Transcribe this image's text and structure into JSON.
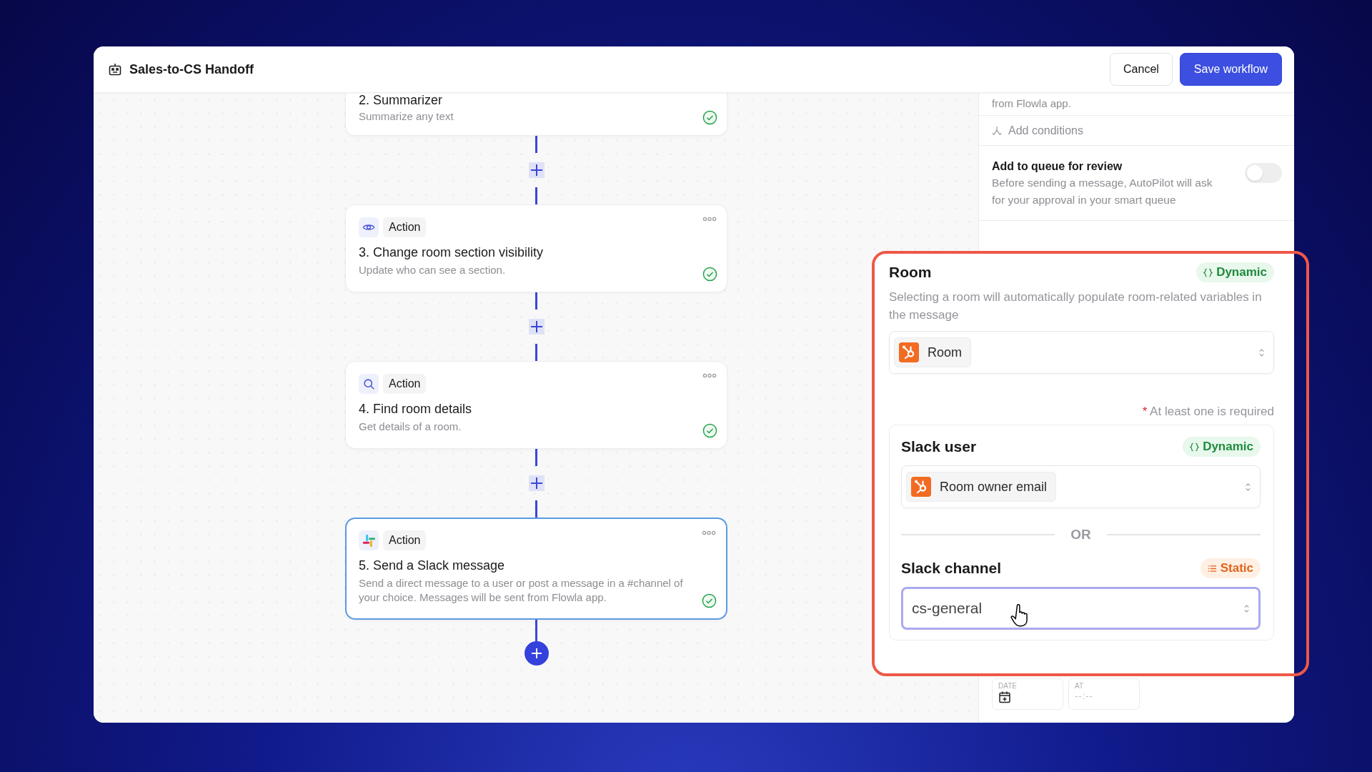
{
  "window": {
    "title": "Sales-to-CS Handoff"
  },
  "header_buttons": [
    {
      "label": "Cancel",
      "kind": "secondary"
    },
    {
      "label": "Save workflow",
      "kind": "primary"
    }
  ],
  "nodes": [
    {
      "title": "2. Summarizer",
      "description": "Summarize any text",
      "done": true,
      "selected": false
    },
    {
      "badge": "Action",
      "kind": "visibility",
      "title": "3. Change room section visibility",
      "description": "Update who can see a section.",
      "done": true,
      "selected": false
    },
    {
      "badge": "Action",
      "kind": "lookup",
      "title": "4. Find room details",
      "description": "Get details of a room.",
      "done": true,
      "selected": false
    },
    {
      "badge": "Action",
      "kind": "slack",
      "title": "5. Send a Slack message",
      "description": "Send a direct message to a user or post a message in a #channel of your choice. Messages will be sent from Flowla app.",
      "done": true,
      "selected": true
    }
  ],
  "settings": {
    "note": "from Flowla app.",
    "add_conditions": "Add conditions",
    "queue": {
      "title": "Add to queue for review",
      "description": "Before sending a message, AutoPilot will ask for your approval in your smart queue",
      "on": false
    },
    "schedule": [
      {
        "label": "DATE",
        "kind": "date"
      },
      {
        "label": "AT",
        "kind": "time",
        "placeholder": "--:--"
      }
    ]
  },
  "room_panel": {
    "title": "Room",
    "mode": {
      "label": "Dynamic",
      "kind": "dynamic"
    },
    "description": "Selecting a room will automatically populate room-related variables in the message",
    "value": "Room",
    "required_mark": "*",
    "required_note": "At least one is required",
    "separator": "OR",
    "recipients": [
      {
        "title": "Slack user",
        "mode": {
          "label": "Dynamic",
          "kind": "dynamic"
        },
        "value": "Room owner email",
        "kind": "variable",
        "focused": false
      },
      {
        "title": "Slack channel",
        "mode": {
          "label": "Static",
          "kind": "static"
        },
        "value": "cs-general",
        "kind": "text",
        "focused": true
      }
    ]
  }
}
